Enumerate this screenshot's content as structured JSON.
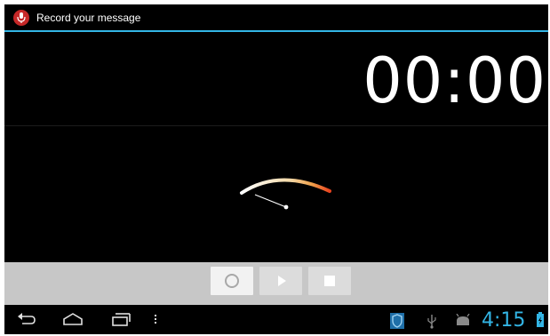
{
  "titlebar": {
    "title": "Record your message",
    "app_icon": "microphone-icon"
  },
  "timer": {
    "value": "00:00"
  },
  "controls": {
    "buttons": [
      {
        "name": "record",
        "icon": "record-icon",
        "selected": true
      },
      {
        "name": "play",
        "icon": "play-icon"
      },
      {
        "name": "stop",
        "icon": "stop-icon"
      }
    ]
  },
  "navbar": {
    "buttons": [
      "back-icon",
      "home-icon",
      "recent-apps-icon",
      "menu-icon"
    ],
    "status_icons": [
      "shield-notification-icon",
      "usb-icon",
      "android-debug-icon",
      "battery-icon"
    ],
    "clock": "4:15"
  },
  "colors": {
    "accent": "#33b5e5",
    "control_bar": "#c7c7c7",
    "meter_start": "#ffffff",
    "meter_end": "#e8431f"
  }
}
